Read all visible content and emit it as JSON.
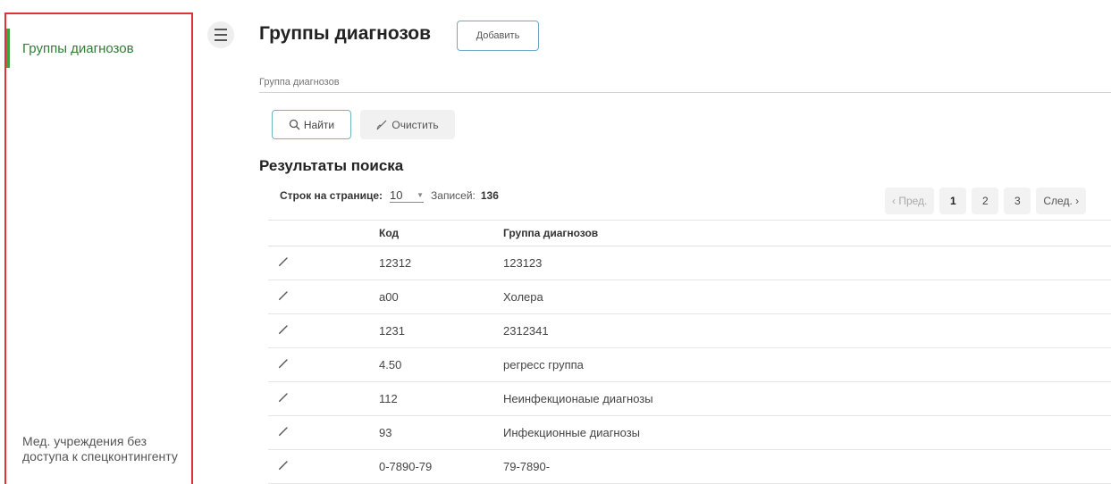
{
  "sidebar": {
    "active_item": "Группы диагнозов",
    "bottom_item": "Мед. учреждения без доступа к спецконтингенту"
  },
  "header": {
    "title": "Группы диагнозов",
    "add_label": "Добавить"
  },
  "filter": {
    "placeholder": "Группа диагнозов",
    "find_label": "Найти",
    "clear_label": "Очистить"
  },
  "results": {
    "title": "Результаты поиска",
    "rows_per_page_label": "Строк на странице:",
    "rows_per_page_value": "10",
    "records_label": "Записей:",
    "records_count": "136",
    "pagination": {
      "prev": "‹ Пред.",
      "pages": [
        "1",
        "2",
        "3"
      ],
      "active_page": "1",
      "next": "След. ›"
    }
  },
  "table": {
    "columns": [
      "Код",
      "Группа диагнозов"
    ],
    "rows": [
      {
        "code": "12312",
        "name": "123123"
      },
      {
        "code": "а00",
        "name": "Холера"
      },
      {
        "code": "1231",
        "name": "2312341"
      },
      {
        "code": "4.50",
        "name": "регресс группа"
      },
      {
        "code": "112",
        "name": "Неинфекционаые диагнозы"
      },
      {
        "code": "93",
        "name": "Инфекционные диагнозы"
      },
      {
        "code": "0-7890-79",
        "name": "79-7890-"
      }
    ]
  },
  "icons": {
    "menu": "menu-icon",
    "search": "search-icon",
    "clear": "broom-icon",
    "edit": "pencil-icon"
  },
  "colors": {
    "accent_green": "#43a047",
    "sidebar_border": "#e0303a",
    "button_border": "#6fb4bf"
  }
}
